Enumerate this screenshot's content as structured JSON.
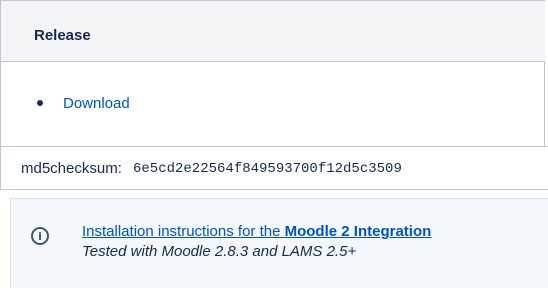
{
  "release_section": {
    "header_title": "Release",
    "download_link": "Download",
    "checksum_label": "md5checksum:",
    "checksum_value": "6e5cd2e22564f849593700f12d5c3509"
  },
  "info_panel": {
    "icon": "info-icon",
    "link_prefix": "Installation instructions for the ",
    "link_bold": "Moodle 2 Integration",
    "tested_text": "Tested with Moodle 2.8.3 and LAMS 2.5+"
  },
  "colors": {
    "link": "#0052cc",
    "text": "#172b4d",
    "header_bg": "#f4f5f7",
    "panel_bg": "#f4f8fd",
    "border": "#c1c7d0"
  }
}
